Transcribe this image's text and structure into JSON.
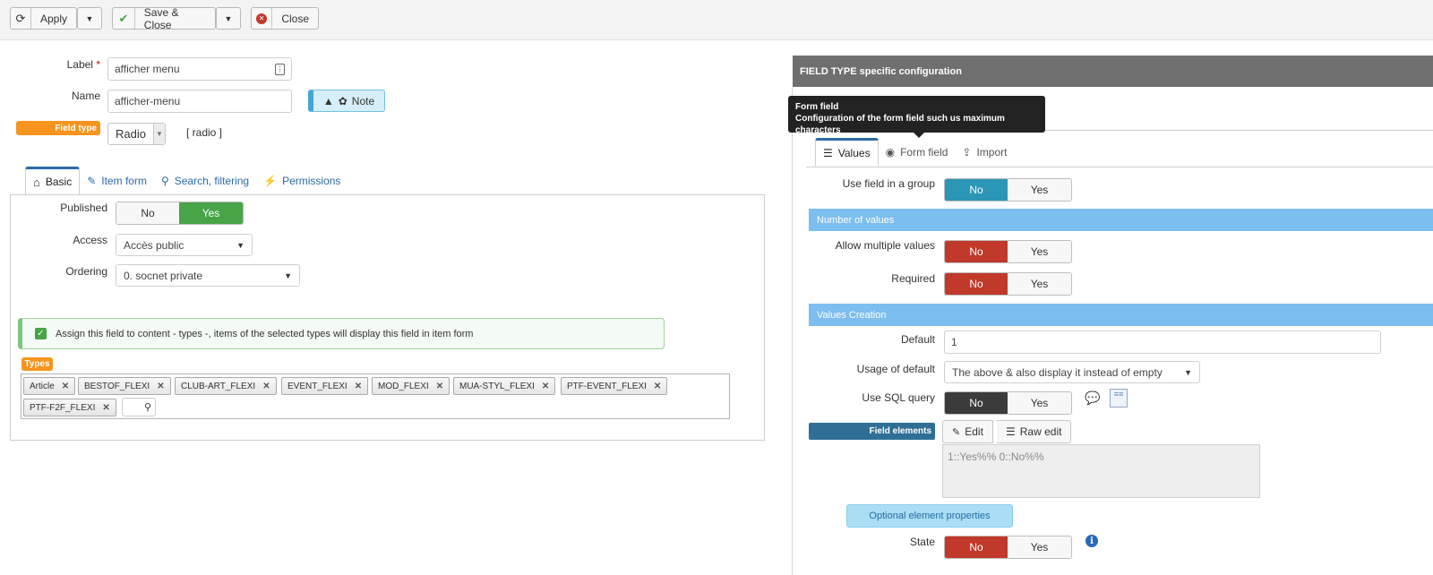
{
  "toolbar": {
    "apply_label": "Apply",
    "save_close_label": "Save & Close",
    "close_label": "Close"
  },
  "form": {
    "label_caption": "Label",
    "label_required_mark": "*",
    "label_value": "afficher menu",
    "name_caption": "Name",
    "name_value": "afficher-menu",
    "note_label": "Note",
    "field_type_caption": "Field type",
    "field_type_value": "Radio",
    "field_type_code": "[ radio ]"
  },
  "tabs": [
    {
      "label": "Basic",
      "icon": "home-icon"
    },
    {
      "label": "Item form",
      "icon": "edit-icon"
    },
    {
      "label": "Search, filtering",
      "icon": "search-icon"
    },
    {
      "label": "Permissions",
      "icon": "plug-icon"
    }
  ],
  "basic": {
    "published_label": "Published",
    "published_no": "No",
    "published_yes": "Yes",
    "access_label": "Access",
    "access_value": "Accès public",
    "ordering_label": "Ordering",
    "ordering_value": "0. socnet private",
    "assign_text": "Assign this field to content - types -, items of the selected types will display this field in item form",
    "types_badge": "Types",
    "types": [
      "Article",
      "BESTOF_FLEXI",
      "CLUB-ART_FLEXI",
      "EVENT_FLEXI",
      "MOD_FLEXI",
      "MUA-STYL_FLEXI",
      "PTF-EVENT_FLEXI",
      "PTF-F2F_FLEXI"
    ]
  },
  "right": {
    "header": "FIELD TYPE specific configuration",
    "tooltip_title": "Form field",
    "tooltip_text": "Configuration of the form field such us maximum characters",
    "subtabs": [
      {
        "label": "Values",
        "icon": "database-icon"
      },
      {
        "label": "Form field",
        "icon": "radio-target-icon"
      },
      {
        "label": "Import",
        "icon": "upload-icon"
      }
    ],
    "use_group_label": "Use field in a group",
    "no": "No",
    "yes": "Yes",
    "section_values": "Number of values",
    "allow_multiple_label": "Allow multiple values",
    "required_label": "Required",
    "section_creation": "Values Creation",
    "default_label": "Default",
    "default_value": "1",
    "usage_default_label": "Usage of default",
    "usage_default_value": "The above & also display it instead of empty",
    "sql_label": "Use SQL query",
    "field_elements_label": "Field elements",
    "edit_label": "Edit",
    "raw_edit_label": "Raw edit",
    "elements_value": "1::Yes%% 0::No%%",
    "optional_props_label": "Optional element properties",
    "state_label": "State",
    "info_glyph": "i"
  },
  "colors": {
    "accent_blue": "#2a6aa8",
    "orange": "#f7941d",
    "green": "#47a447",
    "red": "#c0392b",
    "teal": "#2b96b6",
    "section_blue": "#7cbef0"
  }
}
